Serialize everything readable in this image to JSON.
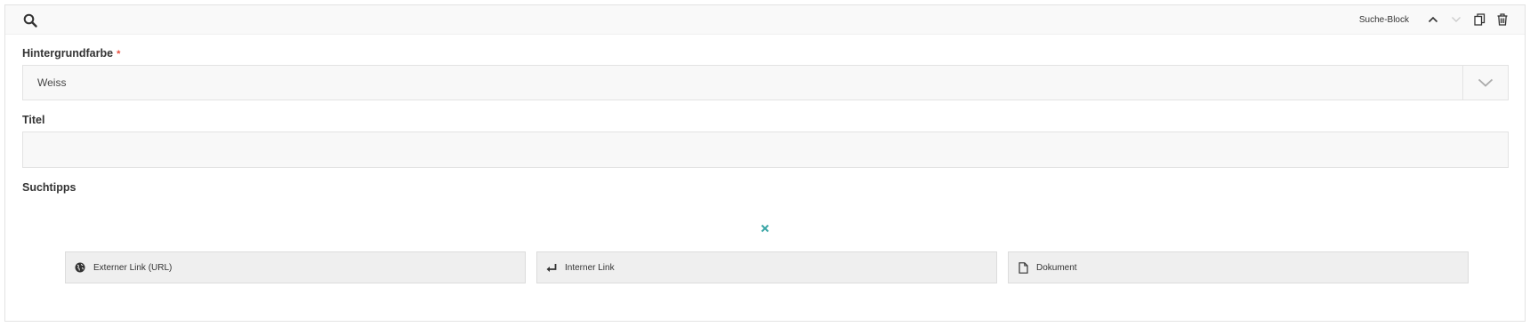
{
  "block": {
    "type_label": "Suche-Block"
  },
  "fields": {
    "background": {
      "label": "Hintergrundfarbe",
      "required_mark": "*",
      "value": "Weiss"
    },
    "title": {
      "label": "Titel",
      "value": ""
    },
    "tips": {
      "label": "Suchtipps",
      "buttons": [
        {
          "label": "Externer Link (URL)",
          "icon": "globe-icon"
        },
        {
          "label": "Interner Link",
          "icon": "enter-arrow-icon"
        },
        {
          "label": "Dokument",
          "icon": "document-icon"
        }
      ]
    }
  },
  "colors": {
    "accent_close": "#3aa6a6",
    "required": "#e74c3c"
  }
}
